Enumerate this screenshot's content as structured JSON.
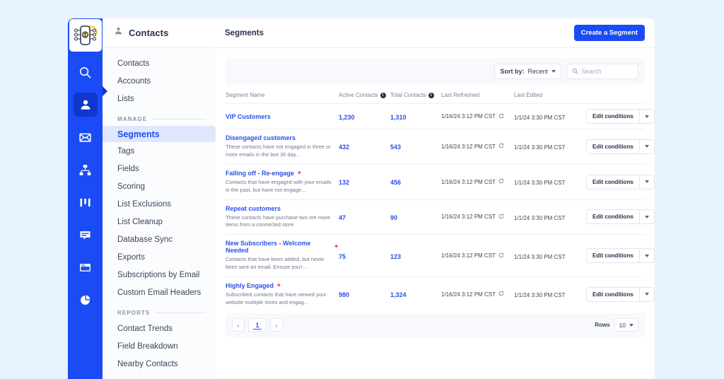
{
  "theme": {
    "page_bg": "#e8f3fd",
    "brand_blue": "#1a4bf5",
    "active_rail": "#1036ce",
    "link_blue": "#2a50e8",
    "nav_active_bg": "#dfe6fd",
    "sparkle_pink": "#e8468f"
  },
  "rail": {
    "logo_name": "contacts-cloud-logo",
    "icons": [
      {
        "name": "search-icon",
        "active": false
      },
      {
        "name": "contacts-person-icon",
        "active": true
      },
      {
        "name": "email-envelope-icon",
        "active": false
      },
      {
        "name": "org-chart-icon",
        "active": false
      },
      {
        "name": "kanban-board-icon",
        "active": false
      },
      {
        "name": "chat-bubble-icon",
        "active": false
      },
      {
        "name": "browser-window-icon",
        "active": false
      },
      {
        "name": "pie-chart-icon",
        "active": false
      }
    ]
  },
  "nav": {
    "header_title": "Contacts",
    "header_icon": "person-icon",
    "items": [
      {
        "label": "Contacts",
        "active": false
      },
      {
        "label": "Accounts",
        "active": false
      },
      {
        "label": "Lists",
        "active": false
      }
    ],
    "manage_section": "MANAGE",
    "manage_items": [
      {
        "label": "Segments",
        "active": true
      },
      {
        "label": "Tags",
        "active": false
      },
      {
        "label": "Fields",
        "active": false
      },
      {
        "label": "Scoring",
        "active": false
      },
      {
        "label": "List Exclusions",
        "active": false
      },
      {
        "label": "List Cleanup",
        "active": false
      },
      {
        "label": "Database Sync",
        "active": false
      },
      {
        "label": "Exports",
        "active": false
      },
      {
        "label": "Subscriptions by Email",
        "active": false
      },
      {
        "label": "Custom Email Headers",
        "active": false
      }
    ],
    "reports_section": "REPORTS",
    "reports_items": [
      {
        "label": "Contact Trends",
        "active": false
      },
      {
        "label": "Field Breakdown",
        "active": false
      },
      {
        "label": "Nearby Contacts",
        "active": false
      }
    ]
  },
  "main": {
    "page_title": "Segments",
    "create_button": "Create a Segment",
    "toolbar": {
      "sort_label": "Sort by:",
      "sort_value": "Recent",
      "search_placeholder": "Search",
      "search_value": ""
    },
    "columns": [
      {
        "label": "Segment Name",
        "info": false
      },
      {
        "label": "Active Contacts",
        "info": true
      },
      {
        "label": "Total Contacts",
        "info": true
      },
      {
        "label": "Last Refreshed",
        "info": false
      },
      {
        "label": "Last Edited",
        "info": false
      }
    ],
    "rows": [
      {
        "name": "VIP Customers",
        "description": "",
        "ai": false,
        "active_contacts": "1,230",
        "total_contacts": "1,310",
        "last_refreshed": "1/16/24 3:12 PM CST",
        "last_edited": "1/1/24 3:30 PM CST",
        "action": "Edit conditions"
      },
      {
        "name": "Disengaged customers",
        "description": "These contacts have not engaged in three or more emails in the last 30 day...",
        "ai": false,
        "active_contacts": "432",
        "total_contacts": "543",
        "last_refreshed": "1/16/24 3:12 PM CST",
        "last_edited": "1/1/24 3:30 PM CST",
        "action": "Edit conditions"
      },
      {
        "name": "Falling off - Re-engage",
        "description": "Contacts that have engaged with your emails in the past, but have not engage...",
        "ai": true,
        "active_contacts": "132",
        "total_contacts": "456",
        "last_refreshed": "1/16/24 3:12 PM CST",
        "last_edited": "1/1/24 3:30 PM CST",
        "action": "Edit conditions"
      },
      {
        "name": "Repeat customers",
        "description": "These contacts have purchase two ore more items from a connected store",
        "ai": false,
        "active_contacts": "47",
        "total_contacts": "90",
        "last_refreshed": "1/16/24 3:12 PM CST",
        "last_edited": "1/1/24 3:30 PM CST",
        "action": "Edit conditions"
      },
      {
        "name": "New Subscribers - Welcome Needed",
        "description": "Contacts that have been added, but never been sent an email. Ensure you'r...",
        "ai": true,
        "active_contacts": "75",
        "total_contacts": "123",
        "last_refreshed": "1/16/24 3:12 PM CST",
        "last_edited": "1/1/24 3:30 PM CST",
        "action": "Edit conditions"
      },
      {
        "name": "Highly Engaged",
        "description": "Subscribed contacts that have viewed your website multiple times and engag...",
        "ai": true,
        "active_contacts": "980",
        "total_contacts": "1,324",
        "last_refreshed": "1/16/24 3:12 PM CST",
        "last_edited": "1/1/24 3:30 PM CST",
        "action": "Edit conditions"
      }
    ],
    "pagination": {
      "prev": "‹",
      "next": "›",
      "current_page": "1",
      "rows_label": "Rows",
      "rows_value": "10"
    }
  }
}
